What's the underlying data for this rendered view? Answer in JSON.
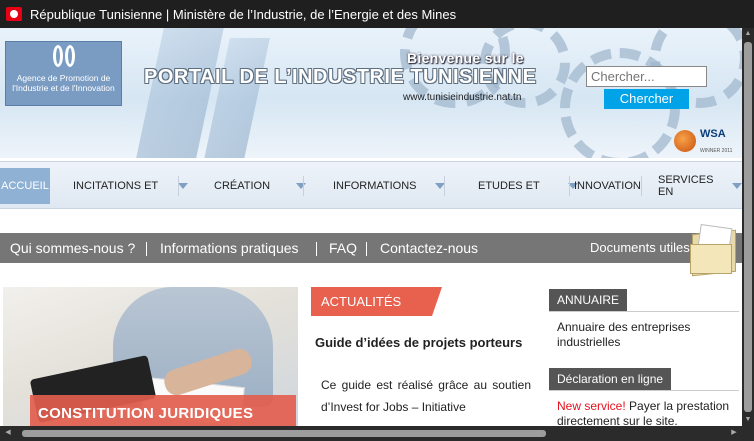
{
  "window": {
    "title": "République Tunisienne | Ministère de l’Industrie, de l’Energie et des Mines"
  },
  "header": {
    "logo_text": "Agence de Promotion de l'Industrie et de l'Innovation",
    "welcome": "Bienvenue sur le",
    "title": "PORTAIL DE L’INDUSTRIE TUNISIENNE",
    "url": "www.tunisieindustrie.nat.tn",
    "award_logo": "WSA",
    "award_sub": "WINNER 2011"
  },
  "search": {
    "placeholder": "Chercher...",
    "button_label": "Chercher"
  },
  "nav": {
    "home": "ACCUEIL",
    "items": [
      {
        "label": "INCITATIONS ET"
      },
      {
        "label": "CRÉATION"
      },
      {
        "label": "INFORMATIONS"
      },
      {
        "label": "ETUDES ET"
      },
      {
        "label": "INNOVATION"
      },
      {
        "label": "SERVICES EN"
      }
    ]
  },
  "subnav": {
    "links": [
      "Qui sommes-nous ?",
      "Informations pratiques",
      "FAQ",
      "Contactez-nous"
    ],
    "docs": "Documents utiles"
  },
  "feature": {
    "caption": "CONSTITUTION JURIDIQUES"
  },
  "news": {
    "tab": "ACTUALITÉS",
    "headline": "Guide d’idées de projets porteurs",
    "text": "Ce guide est réalisé grâce au soutien d’Invest for Jobs – Initiative"
  },
  "sidebar": {
    "annuaire_tab": "ANNUAIRE",
    "annuaire_text": "Annuaire des entreprises industrielles",
    "declaration_tab": "Déclaration en ligne",
    "declaration_new": "New service!",
    "declaration_text": " Payer la prestation directement sur le site."
  },
  "colors": {
    "accent": "#e8604e",
    "search_button": "#00a2e8",
    "nav_home": "#8fb1d4",
    "subbar": "#767676"
  }
}
